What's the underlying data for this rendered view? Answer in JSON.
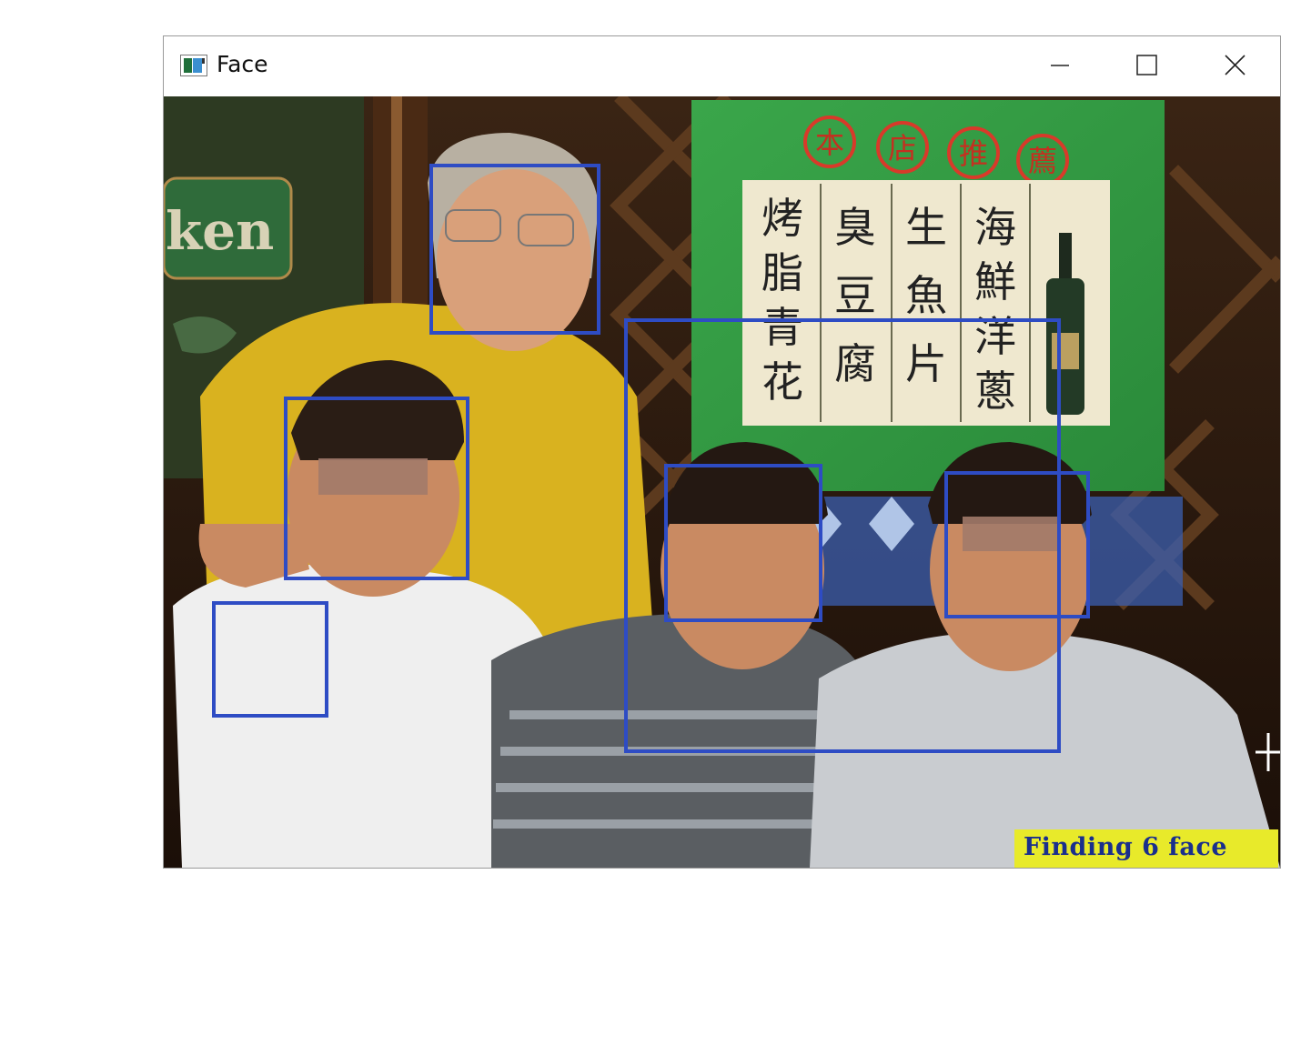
{
  "window": {
    "title": "Face",
    "icon": "app-window-icon",
    "controls": [
      "minimize-icon",
      "maximize-icon",
      "close-icon"
    ]
  },
  "detection": {
    "status_text": "Finding 6 face",
    "face_count": 6,
    "box_color": "#2e4cc4",
    "status_bg": "#e8ea2a",
    "status_fg": "#1a2f8c"
  },
  "scene": {
    "sign_title": [
      "本",
      "店",
      "推",
      "薦"
    ],
    "menu_columns": [
      [
        "烤",
        "脂",
        "青",
        "花"
      ],
      [
        "臭",
        "豆",
        "腐"
      ],
      [
        "生",
        "魚",
        "片"
      ],
      [
        "海",
        "鮮",
        "洋",
        "蔥"
      ]
    ],
    "beer_text": "ken"
  }
}
